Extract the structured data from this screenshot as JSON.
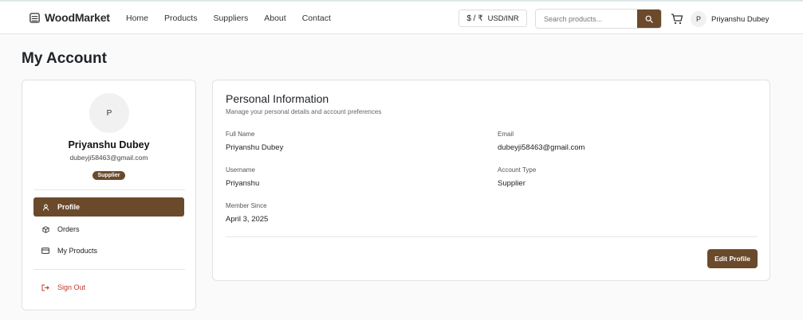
{
  "header": {
    "brand": "WoodMarket",
    "nav": [
      "Home",
      "Products",
      "Suppliers",
      "About",
      "Contact"
    ],
    "currency": {
      "symbol": "$ / ₹",
      "label": "USD/INR"
    },
    "search": {
      "placeholder": "Search products..."
    },
    "user": {
      "initial": "P",
      "name": "Priyanshu Dubey"
    }
  },
  "page": {
    "title": "My Account"
  },
  "sidebar": {
    "avatar_initial": "P",
    "name": "Priyanshu Dubey",
    "email": "dubeyji58463@gmail.com",
    "role_badge": "Supplier",
    "menu": [
      {
        "label": "Profile",
        "icon": "user-icon"
      },
      {
        "label": "Orders",
        "icon": "package-icon"
      },
      {
        "label": "My Products",
        "icon": "card-icon"
      }
    ],
    "sign_out": "Sign Out"
  },
  "personal_info": {
    "title": "Personal Information",
    "subtitle": "Manage your personal details and account preferences",
    "fields": {
      "full_name": {
        "label": "Full Name",
        "value": "Priyanshu Dubey"
      },
      "email": {
        "label": "Email",
        "value": "dubeyji58463@gmail.com"
      },
      "username": {
        "label": "Username",
        "value": "Priyanshu"
      },
      "account_type": {
        "label": "Account Type",
        "value": "Supplier"
      },
      "member_since": {
        "label": "Member Since",
        "value": "April 3, 2025"
      }
    },
    "edit_button": "Edit Profile"
  },
  "colors": {
    "accent": "#6b4a2b",
    "danger": "#c0392b"
  }
}
